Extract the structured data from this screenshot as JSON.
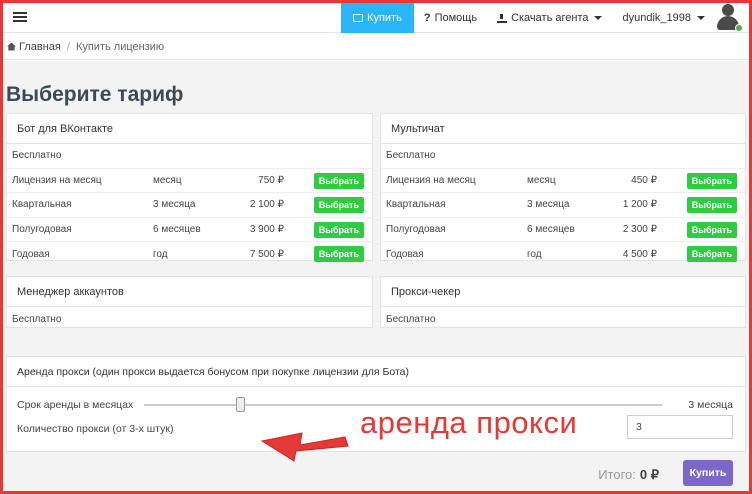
{
  "navbar": {
    "buy_label": "Купить",
    "help_label": "Помощь",
    "download_label": "Скачать агента",
    "username": "dyundik_1998"
  },
  "breadcrumb": {
    "home": "Главная",
    "current": "Купить лицензию"
  },
  "page": {
    "title": "Выберите тариф"
  },
  "plans": [
    {
      "title": "Бот для ВКонтакте",
      "free_label": "Бесплатно",
      "rows": [
        {
          "name": "Лицензия на месяц",
          "period": "месяц",
          "price": "750 ₽",
          "button": "Выбрать"
        },
        {
          "name": "Квартальная",
          "period": "3 месяца",
          "price": "2 100 ₽",
          "button": "Выбрать"
        },
        {
          "name": "Полугодовая",
          "period": "6 месяцев",
          "price": "3 900 ₽",
          "button": "Выбрать"
        },
        {
          "name": "Годовая",
          "period": "год",
          "price": "7 500 ₽",
          "button": "Выбрать"
        }
      ]
    },
    {
      "title": "Мультичат",
      "free_label": "Бесплатно",
      "rows": [
        {
          "name": "Лицензия на месяц",
          "period": "месяц",
          "price": "450 ₽",
          "button": "Выбрать"
        },
        {
          "name": "Квартальная",
          "period": "3 месяца",
          "price": "1 200 ₽",
          "button": "Выбрать"
        },
        {
          "name": "Полугодовая",
          "period": "6 месяцев",
          "price": "2 300 ₽",
          "button": "Выбрать"
        },
        {
          "name": "Годовая",
          "period": "год",
          "price": "4 500 ₽",
          "button": "Выбрать"
        }
      ]
    },
    {
      "title": "Менеджер аккаунтов",
      "free_label": "Бесплатно"
    },
    {
      "title": "Прокси-чекер",
      "free_label": "Бесплатно"
    }
  ],
  "proxy": {
    "title": "Аренда прокси (один прокси выдается бонусом при покупке лицензии для Бота)",
    "months_label": "Срок аренды в месяцах",
    "months_value": "3 месяца",
    "qty_label": "Количество прокси (от 3-х штук)",
    "qty_value": "3"
  },
  "total": {
    "label": "Итого:",
    "value": "0 ₽",
    "buy_button": "Купить"
  },
  "annotation": {
    "text": "аренда прокси"
  },
  "colors": {
    "accent_blue": "#29b6f6",
    "choose_green": "#2ecc40",
    "buy_purple": "#7b68c9",
    "annotation_red": "#e53935"
  }
}
